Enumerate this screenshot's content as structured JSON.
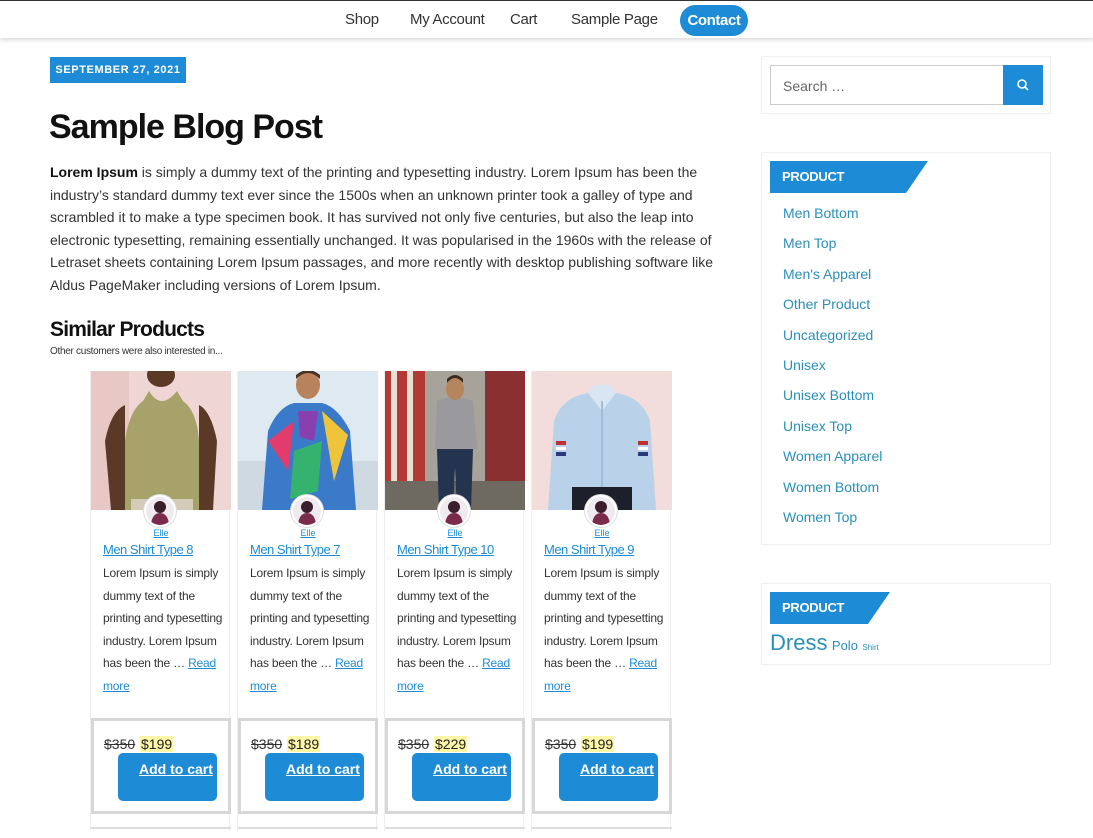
{
  "nav": {
    "items": [
      "Shop",
      "My Account",
      "Cart",
      "Sample Page"
    ],
    "contact": "Contact"
  },
  "post": {
    "date": "SEPTEMBER 27, 2021",
    "title": "Sample Blog Post",
    "body_bold": "Lorem Ipsum",
    "body_rest": " is simply a dummy text of the printing and typesetting industry. Lorem Ipsum has been the industry’s standard dummy text ever since the 1500s when an unknown printer took a galley of type and scrambled it to make a type specimen book. It has survived not only five centuries, but also the leap into electronic typesetting, remaining essentially unchanged. It was popularised in the 1960s with the release of Letraset sheets containing Lorem Ipsum passages, and more recently with desktop publishing software like Aldus PageMaker including versions of Lorem Ipsum."
  },
  "similar": {
    "title": "Similar Products",
    "subtitle": "Other customers were also interested in...",
    "products": [
      {
        "name": "Men Shirt Type 8",
        "author": "Elle",
        "desc": "Lorem Ipsum is simply dummy text of the printing and typesetting industry. Lorem Ipsum has been the …",
        "read_more": "Read more",
        "old_price": "$350",
        "new_price": "$199",
        "cta": "Add to cart"
      },
      {
        "name": "Men Shirt Type 7",
        "author": "Elle",
        "desc": "Lorem Ipsum is simply dummy text of the printing and typesetting industry. Lorem Ipsum has been the …",
        "read_more": "Read more",
        "old_price": "$350",
        "new_price": "$189",
        "cta": "Add to cart"
      },
      {
        "name": "Men Shirt Type 10",
        "author": "Elle",
        "desc": "Lorem Ipsum is simply dummy text of the printing and typesetting industry. Lorem Ipsum has been the …",
        "read_more": "Read more",
        "old_price": "$350",
        "new_price": "$229",
        "cta": "Add to cart"
      },
      {
        "name": "Men Shirt Type 9",
        "author": "Elle",
        "desc": "Lorem Ipsum is simply dummy text of the printing and typesetting industry. Lorem Ipsum has been the …",
        "read_more": "Read more",
        "old_price": "$350",
        "new_price": "$199",
        "cta": "Add to cart"
      }
    ]
  },
  "sidebar": {
    "search_placeholder": "Search …",
    "categories_heading": "PRODUCT CATEGORIES",
    "categories": [
      "Men Bottom",
      "Men Top",
      "Men's Apparel",
      "Other Product",
      "Uncategorized",
      "Unisex",
      "Unisex Bottom",
      "Unisex Top",
      "Women Apparel",
      "Women Bottom",
      "Women Top"
    ],
    "tags_heading": "PRODUCT TAGS",
    "tags": [
      {
        "label": "Dress",
        "weight": "large"
      },
      {
        "label": "Polo",
        "weight": "medium"
      },
      {
        "label": "Shirt",
        "weight": "small"
      }
    ]
  },
  "colors": {
    "accent": "#1d8bd5",
    "link": "#2a8fb8",
    "price_highlight": "#fff6a8"
  }
}
